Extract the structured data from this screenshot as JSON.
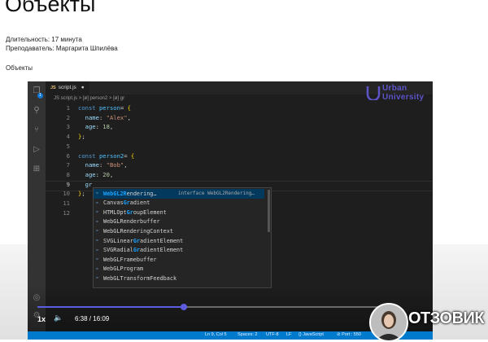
{
  "page": {
    "title": "Объекты",
    "duration": "Длительность: 17 минута",
    "teacher": "Преподаватель: Маргарита Шпилёва",
    "section": "Объекты"
  },
  "editor": {
    "tab_icon": "JS",
    "tab_name": "script.js",
    "tab_dirty": "●",
    "breadcrumb": [
      "JS script.js",
      ">",
      "[ø] person2",
      ">",
      "[ø] gr"
    ],
    "logo": [
      "Urban",
      "University"
    ],
    "lines": [
      {
        "n": "1",
        "tokens": [
          [
            "kw",
            "const "
          ],
          [
            "var",
            "person"
          ],
          [
            "",
            "= "
          ],
          [
            "br",
            "{"
          ]
        ]
      },
      {
        "n": "2",
        "tokens": [
          [
            "",
            "  "
          ],
          [
            "prop",
            "name"
          ],
          [
            "",
            ": "
          ],
          [
            "str",
            "\"Alex\""
          ],
          [
            "",
            ","
          ]
        ]
      },
      {
        "n": "3",
        "tokens": [
          [
            "",
            "  "
          ],
          [
            "prop",
            "age"
          ],
          [
            "",
            ": "
          ],
          [
            "num",
            "18"
          ],
          [
            "",
            ","
          ]
        ]
      },
      {
        "n": "4",
        "tokens": [
          [
            "br",
            "}"
          ],
          [
            "",
            ";"
          ]
        ]
      },
      {
        "n": "5",
        "tokens": []
      },
      {
        "n": "6",
        "tokens": [
          [
            "kw",
            "const "
          ],
          [
            "var",
            "person2"
          ],
          [
            "",
            "= "
          ],
          [
            "br",
            "{"
          ]
        ]
      },
      {
        "n": "7",
        "tokens": [
          [
            "",
            "  "
          ],
          [
            "prop",
            "name"
          ],
          [
            "",
            ": "
          ],
          [
            "str",
            "\"Bob\""
          ],
          [
            "",
            ","
          ]
        ]
      },
      {
        "n": "8",
        "tokens": [
          [
            "",
            "  "
          ],
          [
            "prop",
            "age"
          ],
          [
            "",
            ": "
          ],
          [
            "num",
            "20"
          ],
          [
            "",
            ","
          ]
        ]
      },
      {
        "n": "9",
        "tokens": [
          [
            "",
            "  "
          ],
          [
            "prop",
            "gr"
          ]
        ]
      },
      {
        "n": "10",
        "tokens": [
          [
            "br",
            "}"
          ],
          [
            "",
            ";"
          ]
        ]
      },
      {
        "n": "11",
        "tokens": []
      },
      {
        "n": "12",
        "tokens": []
      }
    ],
    "active_line": "9",
    "suggestions": [
      {
        "pre": "",
        "hl": "WebGL2R",
        "post": "endering…",
        "detail": "interface WebGL2Rendering…"
      },
      {
        "pre": "Canvas",
        "hl": "Gr",
        "post": "adient",
        "detail": ""
      },
      {
        "pre": "HTMLOpt",
        "hl": "Gr",
        "post": "oupElement",
        "detail": ""
      },
      {
        "pre": "WebGLR",
        "hl": "",
        "post": "enderbuffer",
        "detail": ""
      },
      {
        "pre": "WebGLR",
        "hl": "",
        "post": "enderingContext",
        "detail": ""
      },
      {
        "pre": "SVGLinear",
        "hl": "Gr",
        "post": "adientElement",
        "detail": ""
      },
      {
        "pre": "SVGRadial",
        "hl": "Gr",
        "post": "adientElement",
        "detail": ""
      },
      {
        "pre": "WebGLF",
        "hl": "",
        "post": "ramebuffer",
        "detail": ""
      },
      {
        "pre": "WebGLP",
        "hl": "",
        "post": "rogram",
        "detail": ""
      },
      {
        "pre": "WebGLT",
        "hl": "",
        "post": "ransformFeedback",
        "detail": ""
      }
    ],
    "status": [
      "Ln 9, Col 5",
      "Spaces: 2",
      "UTF-8",
      "LF",
      "{} JavaScript",
      "⊘ Port : 550"
    ]
  },
  "player": {
    "speed": "1x",
    "time": "6:38 / 16:09",
    "progress_fraction": 0.411
  },
  "watermark": "ОТЗОВИК",
  "colors": {
    "accent": "#5c5ce0",
    "status_bar": "#007acc",
    "logo": "#5d55c9"
  }
}
